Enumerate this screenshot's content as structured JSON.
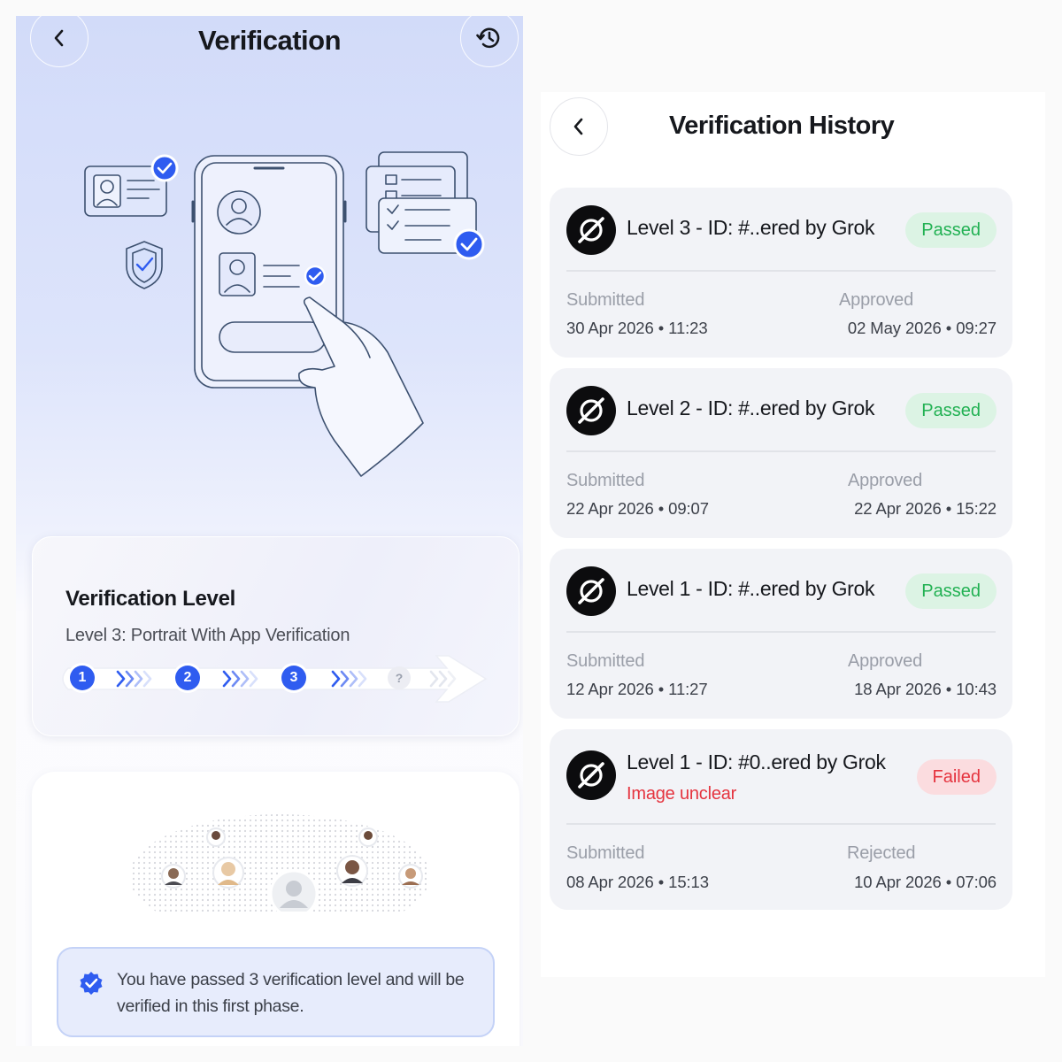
{
  "verification_screen": {
    "title": "Verification",
    "back_icon": "chevron-left-icon",
    "history_icon": "history-clock-icon",
    "level_card": {
      "title": "Verification Level",
      "subtitle": "Level 3: Portrait With App Verification",
      "steps": [
        "1",
        "2",
        "3",
        "?"
      ],
      "accent_color": "#2f5cf0"
    },
    "note": {
      "icon": "verified-badge-icon",
      "text": "You have passed 3 verification level and will be verified in this first phase."
    }
  },
  "history_screen": {
    "title": "Verification History",
    "back_icon": "chevron-left-icon",
    "entries": [
      {
        "title": "Level 3 - ID: #..ered by Grok",
        "status": "Passed",
        "submitted_label": "Submitted",
        "submitted_value": "30 Apr 2026 • 11:23",
        "result_label": "Approved",
        "result_value": "02 May 2026 • 09:27"
      },
      {
        "title": "Level 2 - ID: #..ered by Grok",
        "status": "Passed",
        "submitted_label": "Submitted",
        "submitted_value": "22 Apr 2026 • 09:07",
        "result_label": "Approved",
        "result_value": "22 Apr 2026 • 15:22"
      },
      {
        "title": "Level 1 - ID: #..ered by Grok",
        "status": "Passed",
        "submitted_label": "Submitted",
        "submitted_value": "12 Apr 2026 • 11:27",
        "result_label": "Approved",
        "result_value": "18 Apr 2026 • 10:43"
      },
      {
        "title": "Level 1 - ID: #0..ered by Grok",
        "reason": "Image unclear",
        "status": "Failed",
        "submitted_label": "Submitted",
        "submitted_value": "08 Apr 2026 • 15:13",
        "result_label": "Rejected",
        "result_value": "10 Apr 2026 • 07:06"
      }
    ],
    "colors": {
      "passed": "#22b153",
      "failed": "#e5343f"
    }
  }
}
